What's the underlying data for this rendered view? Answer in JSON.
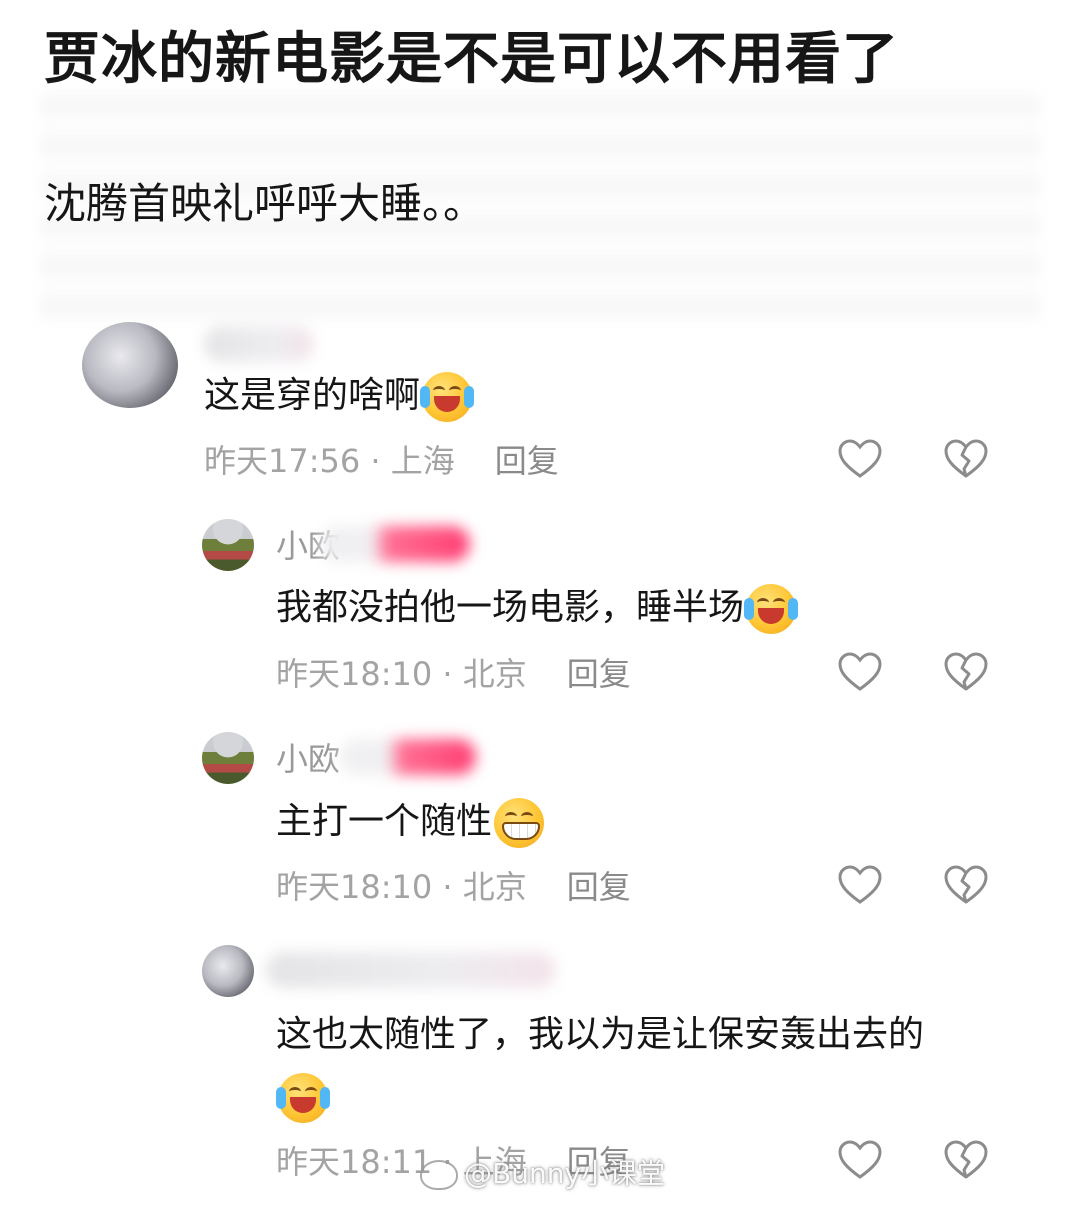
{
  "post": {
    "title": "贾冰的新电影是不是可以不用看了",
    "body": "沈腾首映礼呼呼大睡。。"
  },
  "comments": [
    {
      "name_prefix": "",
      "text": "这是穿的啥啊",
      "emoji": "rolling-laughing-crying-emoji",
      "time_location": "昨天17:56 · 上海",
      "reply_label": "回复"
    },
    {
      "name_prefix": "小欧",
      "text": "我都没拍他一场电影，睡半场",
      "emoji": "rolling-laughing-crying-emoji",
      "time_location": "昨天18:10 · 北京",
      "reply_label": "回复"
    },
    {
      "name_prefix": "小欧",
      "text": "主打一个随性",
      "emoji": "grinning-teeth-emoji",
      "time_location": "昨天18:10 · 北京",
      "reply_label": "回复"
    },
    {
      "name_prefix": "",
      "text": "这也太随性了，我以为是让保安轰出去的",
      "emoji": "rolling-laughing-crying-emoji",
      "time_location": "昨天18:11 · 上海",
      "reply_label": "回复"
    }
  ],
  "icons": {
    "like": "heart-outline-icon",
    "dislike": "broken-heart-icon"
  },
  "colors": {
    "meta_text": "#a3a3a3",
    "body_text": "#161616",
    "icon_stroke": "#8c8c8c"
  },
  "watermark": {
    "text": "@Bunny小课堂"
  }
}
